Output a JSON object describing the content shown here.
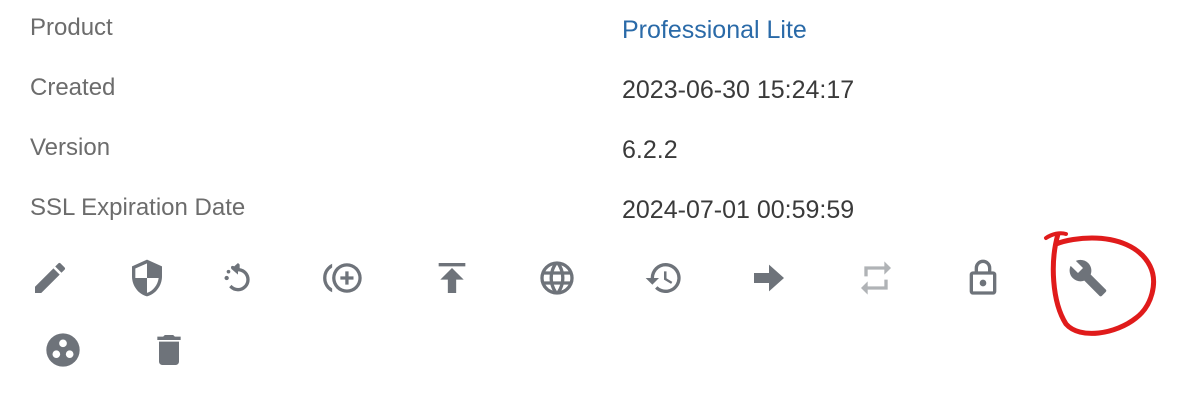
{
  "details": [
    {
      "label": "Product",
      "value": "Professional Lite",
      "is_link": true
    },
    {
      "label": "Created",
      "value": "2023-06-30 15:24:17",
      "is_link": false
    },
    {
      "label": "Version",
      "value": "6.2.2",
      "is_link": false
    },
    {
      "label": "SSL Expiration Date",
      "value": "2024-07-01 00:59:59",
      "is_link": false
    }
  ],
  "actions": [
    {
      "icon": "pencil-icon",
      "name": "edit-button",
      "enabled": true
    },
    {
      "icon": "shield-icon",
      "name": "security-button",
      "enabled": true
    },
    {
      "icon": "restart-icon",
      "name": "restart-button",
      "enabled": true
    },
    {
      "icon": "add-circle-icon",
      "name": "add-button",
      "enabled": true
    },
    {
      "icon": "upload-icon",
      "name": "upload-button",
      "enabled": true
    },
    {
      "icon": "globe-icon",
      "name": "domain-button",
      "enabled": true
    },
    {
      "icon": "history-icon",
      "name": "restore-button",
      "enabled": true
    },
    {
      "icon": "arrow-right-icon",
      "name": "forward-button",
      "enabled": true
    },
    {
      "icon": "repeat-icon",
      "name": "sync-button",
      "enabled": false
    },
    {
      "icon": "lock-icon",
      "name": "lock-button",
      "enabled": true
    },
    {
      "icon": "wrench-icon",
      "name": "settings-button",
      "enabled": true
    },
    {
      "icon": "circles-icon",
      "name": "cluster-button",
      "enabled": true
    },
    {
      "icon": "trash-icon",
      "name": "delete-button",
      "enabled": true
    }
  ],
  "colors": {
    "label": "#6c6c6c",
    "value": "#3a3a3a",
    "link": "#2a6aa8",
    "icon": "#6e737a",
    "icon_disabled": "#b0b3b6",
    "annotation": "#e01b1b"
  }
}
